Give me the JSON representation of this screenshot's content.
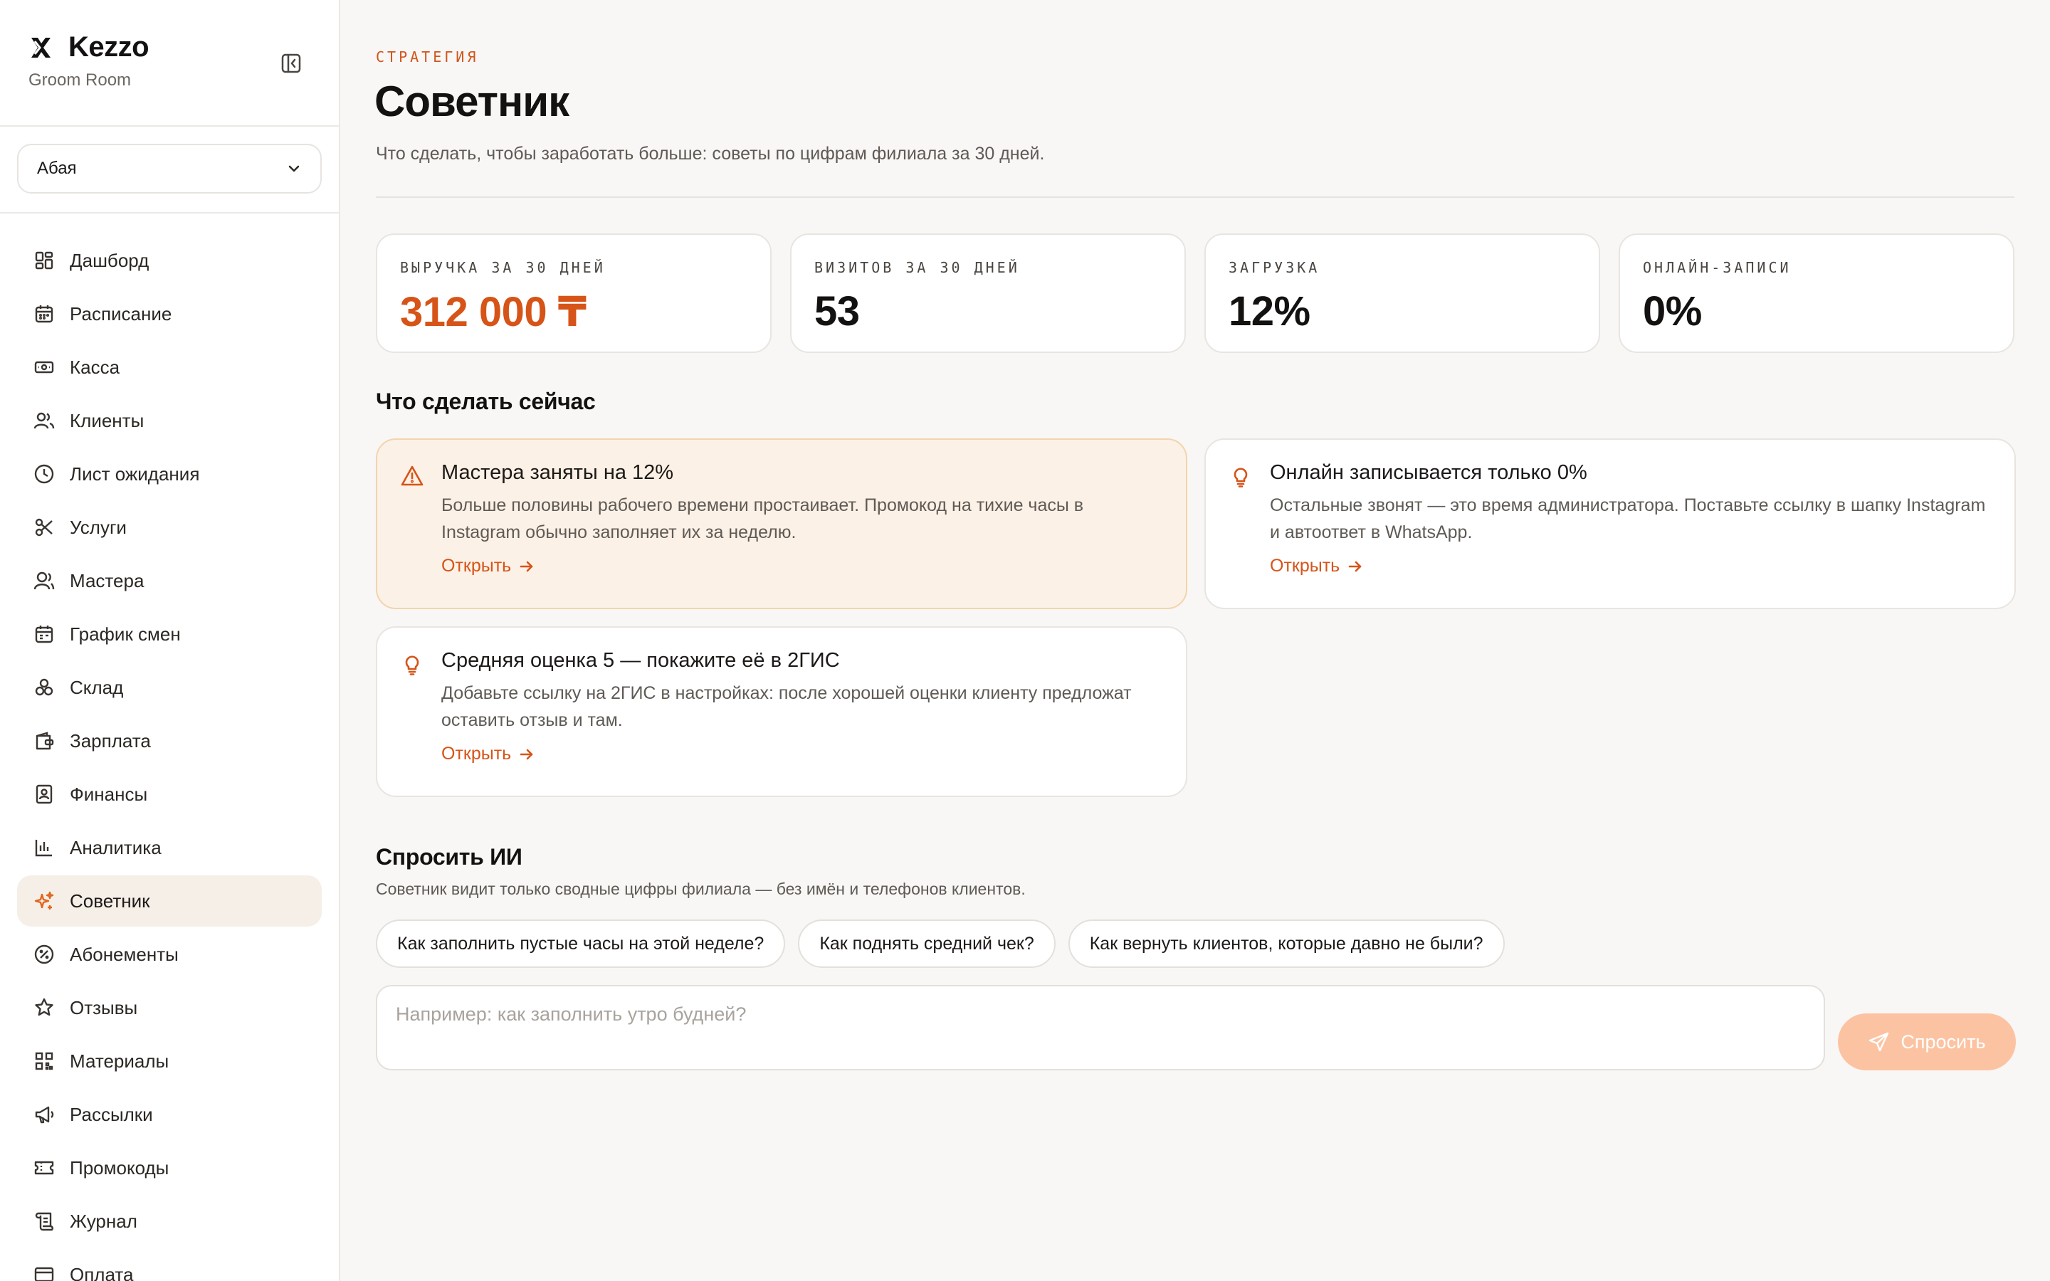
{
  "brand": {
    "name": "Kezzo",
    "subtitle": "Groom Room"
  },
  "branch": {
    "selected": "Абая"
  },
  "nav": {
    "items": [
      {
        "label": "Дашборд",
        "icon": "dashboard-icon"
      },
      {
        "label": "Расписание",
        "icon": "calendar-icon"
      },
      {
        "label": "Касса",
        "icon": "cash-icon"
      },
      {
        "label": "Клиенты",
        "icon": "users-icon"
      },
      {
        "label": "Лист ожидания",
        "icon": "clock-icon"
      },
      {
        "label": "Услуги",
        "icon": "scissors-icon"
      },
      {
        "label": "Мастера",
        "icon": "masters-icon"
      },
      {
        "label": "График смен",
        "icon": "shift-calendar-icon"
      },
      {
        "label": "Склад",
        "icon": "warehouse-icon"
      },
      {
        "label": "Зарплата",
        "icon": "wallet-icon"
      },
      {
        "label": "Финансы",
        "icon": "finance-icon"
      },
      {
        "label": "Аналитика",
        "icon": "chart-icon"
      },
      {
        "label": "Советник",
        "icon": "sparkles-icon",
        "active": true
      },
      {
        "label": "Абонементы",
        "icon": "subscription-icon"
      },
      {
        "label": "Отзывы",
        "icon": "star-icon"
      },
      {
        "label": "Материалы",
        "icon": "qr-icon"
      },
      {
        "label": "Рассылки",
        "icon": "megaphone-icon"
      },
      {
        "label": "Промокоды",
        "icon": "ticket-icon"
      },
      {
        "label": "Журнал",
        "icon": "journal-icon"
      },
      {
        "label": "Оплата",
        "icon": "card-icon"
      }
    ]
  },
  "page": {
    "eyebrow": "СТРАТЕГИЯ",
    "title": "Советник",
    "subtitle": "Что сделать, чтобы заработать больше: советы по цифрам филиала за 30 дней."
  },
  "kpis": [
    {
      "label": "ВЫРУЧКА ЗА 30 ДНЕЙ",
      "value": "312 000 ₸"
    },
    {
      "label": "ВИЗИТОВ ЗА 30 ДНЕЙ",
      "value": "53"
    },
    {
      "label": "ЗАГРУЗКА",
      "value": "12%"
    },
    {
      "label": "ОНЛАЙН-ЗАПИСИ",
      "value": "0%"
    }
  ],
  "actions": {
    "title": "Что сделать сейчас",
    "cards": [
      {
        "title": "Мастера заняты на 12%",
        "text": "Больше половины рабочего времени простаивает. Промокод на тихие часы в Instagram обычно заполняет их за неделю.",
        "link": "Открыть",
        "icon": "warning-icon"
      },
      {
        "title": "Онлайн записывается только 0%",
        "text": "Остальные звонят — это время администратора. Поставьте ссылку в шапку Instagram и автоответ в WhatsApp.",
        "link": "Открыть",
        "icon": "lightbulb-icon"
      },
      {
        "title": "Средняя оценка 5 — покажите её в 2ГИС",
        "text": "Добавьте ссылку на 2ГИС в настройках: после хорошей оценки клиенту предложат оставить отзыв и там.",
        "link": "Открыть",
        "icon": "lightbulb-icon"
      }
    ]
  },
  "ai": {
    "title": "Спросить ИИ",
    "note": "Советник видит только сводные цифры филиала — без имён и телефонов клиентов.",
    "chips": [
      "Как заполнить пустые часы на этой неделе?",
      "Как поднять средний чек?",
      "Как вернуть клиентов, которые давно не были?"
    ],
    "placeholder": "Например: как заполнить утро будней?",
    "value": "",
    "button": "Спросить"
  },
  "colors": {
    "accent": "#d65418",
    "warn_bg": "#fcf1e6",
    "warn_border": "#f3d4ad",
    "active_nav_bg": "#f5efe8",
    "button_disabled": "#fcc3a2"
  }
}
